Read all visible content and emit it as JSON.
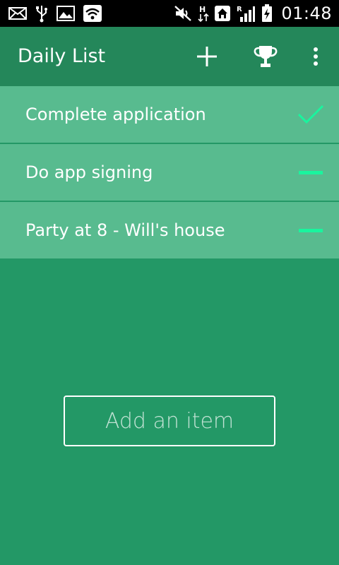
{
  "status_bar": {
    "time": "01:48",
    "icons": [
      "mail-icon",
      "usb-icon",
      "image-icon",
      "wifi-icon",
      "mute-icon",
      "data-h-icon",
      "home-icon",
      "signal-r-icon",
      "battery-charging-icon"
    ]
  },
  "app_bar": {
    "title": "Daily List",
    "actions": [
      "add-icon",
      "trophy-icon",
      "overflow-menu-icon"
    ]
  },
  "list": {
    "items": [
      {
        "label": "Complete application",
        "status": "done"
      },
      {
        "label": "Do app signing",
        "status": "pending"
      },
      {
        "label": "Party at 8 - Will's house",
        "status": "pending"
      }
    ]
  },
  "add_button": {
    "label": "Add an item"
  },
  "colors": {
    "background": "#239866",
    "app_bar": "#24875a",
    "item_bg": "#58bb8f",
    "accent": "#19f59e"
  }
}
